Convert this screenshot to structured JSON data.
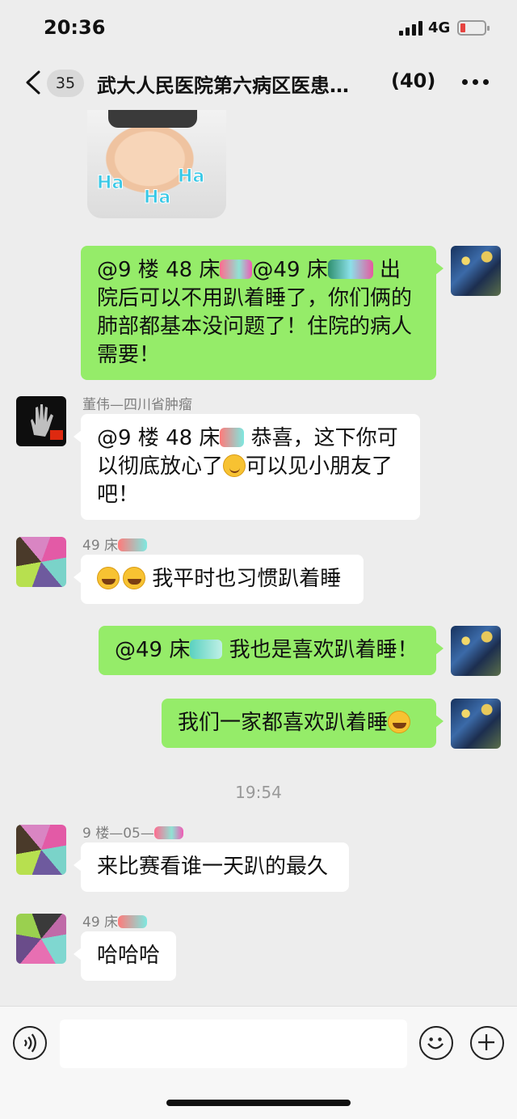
{
  "status_bar": {
    "time": "20:36",
    "network": "4G"
  },
  "nav": {
    "unread_count": "35",
    "title": "武大人民医院第六病区医患…",
    "member_count": "(40)"
  },
  "sticker": {
    "text1": "Ha",
    "text2": "Ha",
    "text3": "Ha"
  },
  "messages": [
    {
      "side": "right",
      "p1": "@9 楼 48 床",
      "p2": "@49 床",
      "p3": " 出院后可以不用趴着睡了，你们俩的肺部都基本没问题了！住院的病人需要！"
    },
    {
      "side": "left",
      "sender": "董伟—四川省肿瘤",
      "p1": "@9 楼 48 床",
      "p2": " 恭喜，这下你可以彻底放心了",
      "p3": "可以见小朋友了吧！"
    },
    {
      "side": "left",
      "sender": "49 床",
      "text": "我平时也习惯趴着睡"
    },
    {
      "side": "right",
      "p1": "@49 床",
      "p2": " 我也是喜欢趴着睡！"
    },
    {
      "side": "right",
      "text": "我们一家都喜欢趴着睡"
    },
    {
      "side": "left",
      "sender": "9 楼—05—",
      "text": "来比赛看谁一天趴的最久"
    },
    {
      "side": "left",
      "sender": "49 床",
      "text": "哈哈哈"
    }
  ],
  "timestamp": "19:54",
  "icons": {
    "back": "chevron-left-icon",
    "more": "more-dots-icon",
    "voice": "voice-icon",
    "emoji": "emoji-icon",
    "plus": "plus-icon"
  },
  "colors": {
    "bubble_self": "#95ec69",
    "bubble_other": "#ffffff",
    "background": "#ededed"
  }
}
